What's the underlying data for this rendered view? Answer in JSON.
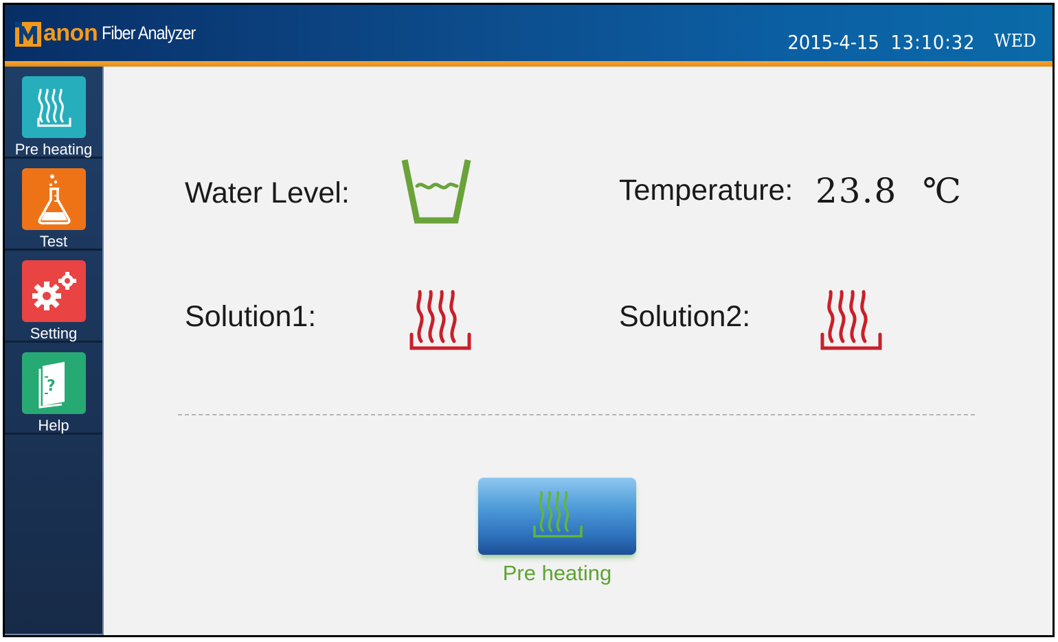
{
  "header": {
    "brand": "anon",
    "product": "Fiber Analyzer",
    "date": "2015-4-15",
    "time": "13:10:32",
    "weekday": "WED",
    "colors": {
      "bar": "#0b4c8c",
      "strip": "#e9931e",
      "brand": "#f39a1b"
    }
  },
  "sidebar": {
    "items": [
      {
        "label": "Pre heating",
        "icon": "heating-icon",
        "color": "#27aebc"
      },
      {
        "label": "Test",
        "icon": "flask-icon",
        "color": "#ee7316"
      },
      {
        "label": "Setting",
        "icon": "gears-icon",
        "color": "#e94343"
      },
      {
        "label": "Help",
        "icon": "help-book-icon",
        "color": "#27a974"
      }
    ]
  },
  "main": {
    "water_level_label": "Water Level:",
    "temperature_label": "Temperature:",
    "temperature_value": "23.8",
    "temperature_unit": "℃",
    "solution1_label": "Solution1:",
    "solution2_label": "Solution2:",
    "water_level_icon": "water-cup-icon",
    "solution_icon": "heater-icon",
    "colors": {
      "water": "#6aa33a",
      "heater": "#c8202a",
      "button_label": "#5ea332"
    }
  },
  "action_button": {
    "label": "Pre heating",
    "icon": "heating-icon"
  }
}
